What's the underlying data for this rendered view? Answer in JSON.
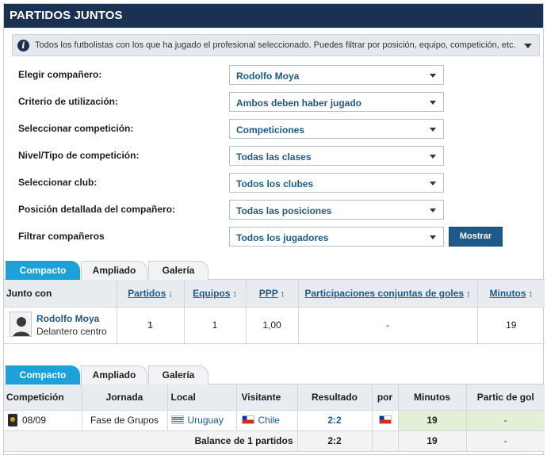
{
  "header": {
    "title": "PARTIDOS JUNTOS"
  },
  "info": {
    "text": "Todos los futbolistas con los que ha jugado el profesional seleccionado. Puedes filtrar por posición, equipo, competición, etc."
  },
  "filters": [
    {
      "label": "Elegir compañero:",
      "value": "Rodolfo Moya"
    },
    {
      "label": "Criterio de utilización:",
      "value": "Ambos deben haber jugado"
    },
    {
      "label": "Seleccionar competición:",
      "value": "Competiciones"
    },
    {
      "label": "Nivel/Tipo de competición:",
      "value": "Todas las clases"
    },
    {
      "label": "Seleccionar club:",
      "value": "Todos los clubes"
    },
    {
      "label": "Posición detallada del compañero:",
      "value": "Todas las posiciones"
    },
    {
      "label": "Filtrar compañeros",
      "value": "Todos los jugadores"
    }
  ],
  "show_button": "Mostrar",
  "tabs": [
    "Compacto",
    "Ampliado",
    "Galería"
  ],
  "summary_table": {
    "headers": {
      "player": "Junto con",
      "matches": "Partidos",
      "teams": "Equipos",
      "ppp": "PPP",
      "goal_participations": "Participaciones conjuntas de goles",
      "minutes": "Minutos"
    },
    "row": {
      "name": "Rodolfo Moya",
      "position": "Delantero centro",
      "matches": "1",
      "teams": "1",
      "ppp": "1,00",
      "goal_participations": "-",
      "minutes": "19"
    }
  },
  "matches_table": {
    "headers": {
      "competition": "Competición",
      "matchday": "Jornada",
      "home": "Local",
      "away": "Visitante",
      "result": "Resultado",
      "by": "por",
      "minutes": "Minutos",
      "goal_part": "Partic de gol"
    },
    "row": {
      "date": "08/09",
      "matchday": "Fase de Grupos",
      "home": "Uruguay",
      "away": "Chile",
      "result": "2:2",
      "minutes": "19",
      "goal_part": "-"
    },
    "footer": {
      "label": "Balance de 1 partidos",
      "result": "2:2",
      "minutes": "19",
      "goal_part": "-"
    }
  },
  "colors": {
    "header_bg": "#1a3151",
    "accent": "#1ea0da",
    "link": "#1d5a8a",
    "button": "#1d5a8a",
    "minutes_highlight": "#e3f0d8"
  }
}
